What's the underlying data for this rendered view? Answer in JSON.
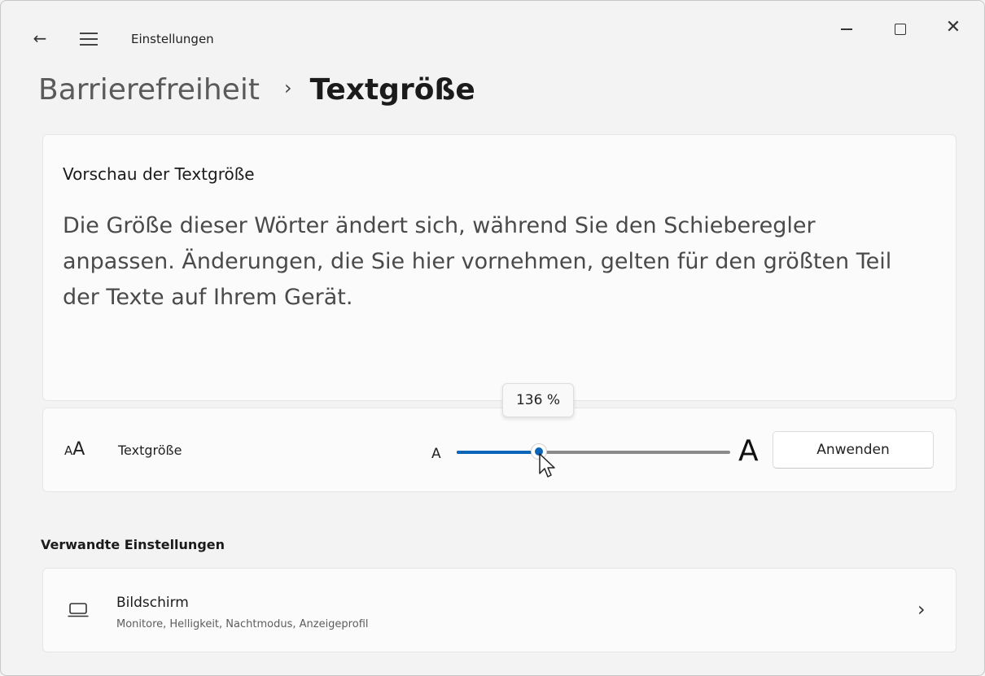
{
  "window": {
    "title": "Einstellungen",
    "back_glyph": "←",
    "close_glyph": "✕"
  },
  "breadcrumb": {
    "parent": "Barrierefreiheit",
    "separator": "›",
    "current": "Textgröße"
  },
  "preview": {
    "title": "Vorschau der Textgröße",
    "text": "Die Größe dieser Wörter ändert sich, während Sie den Schieberegler anpassen. Änderungen, die Sie hier vornehmen, gelten für den größten Teil der Texte auf Ihrem Gerät."
  },
  "text_size": {
    "icon_small": "A",
    "icon_large": "A",
    "label": "Textgröße",
    "slider_min_label": "A",
    "slider_max_label": "A",
    "slider_value_fraction": 0.3,
    "tooltip": "136 %",
    "apply_label": "Anwenden"
  },
  "related": {
    "heading": "Verwandte Einstellungen",
    "items": [
      {
        "title": "Bildschirm",
        "subtitle": "Monitore, Helligkeit, Nachtmodus, Anzeigeprofil",
        "icon": "monitor-icon",
        "chevron": "›"
      }
    ]
  },
  "colors": {
    "accent": "#0a64b8",
    "background": "#f3f3f3",
    "card": "#fbfbfb"
  }
}
